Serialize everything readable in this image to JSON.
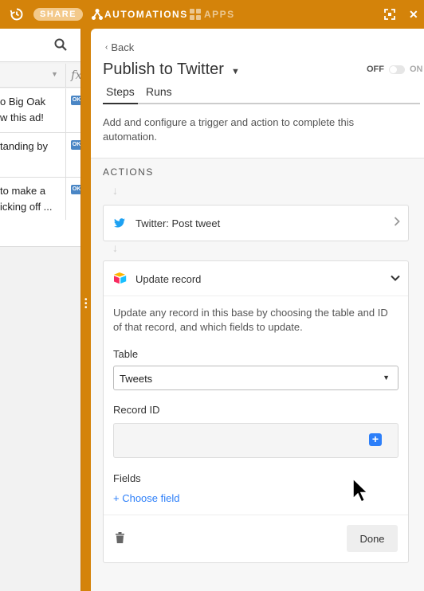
{
  "topbar": {
    "share_label": "SHARE",
    "automations_label": "AUTOMATIONS",
    "apps_label": "APPS",
    "close_glyph": "✕",
    "icons": [
      "history-icon",
      "automations-icon",
      "apps-icon",
      "expand-icon",
      "close-icon"
    ]
  },
  "left_grid": {
    "rows": [
      {
        "line1": "o Big Oak",
        "line2": "w this ad!",
        "badge": "OK"
      },
      {
        "line1": "tanding by",
        "line2": "",
        "badge": "OK"
      },
      {
        "line1": " to make a",
        "line2": "icking off ...",
        "badge": "OK"
      }
    ]
  },
  "panel": {
    "back_label": "Back",
    "title": "Publish to Twitter",
    "toggle": {
      "off_label": "OFF",
      "on_label": "ON",
      "state": "off"
    },
    "tabs": [
      {
        "label": "Steps",
        "active": true
      },
      {
        "label": "Runs",
        "active": false
      }
    ],
    "description": "Add and configure a trigger and action to complete this automation.",
    "actions_label": "ACTIONS",
    "twitter_card": {
      "title": "Twitter: Post tweet"
    },
    "update_card": {
      "title": "Update record",
      "description": "Update any record in this base by choosing the table and ID of that record, and which fields to update.",
      "table_label": "Table",
      "table_value": "Tweets",
      "record_id_label": "Record ID",
      "record_id_value": "",
      "fields_label": "Fields",
      "choose_field_label": "+ Choose field",
      "done_label": "Done"
    }
  },
  "colors": {
    "topbar": "#d4830a",
    "accent_blue": "#2d7ff9",
    "twitter_blue": "#1da1f2"
  }
}
